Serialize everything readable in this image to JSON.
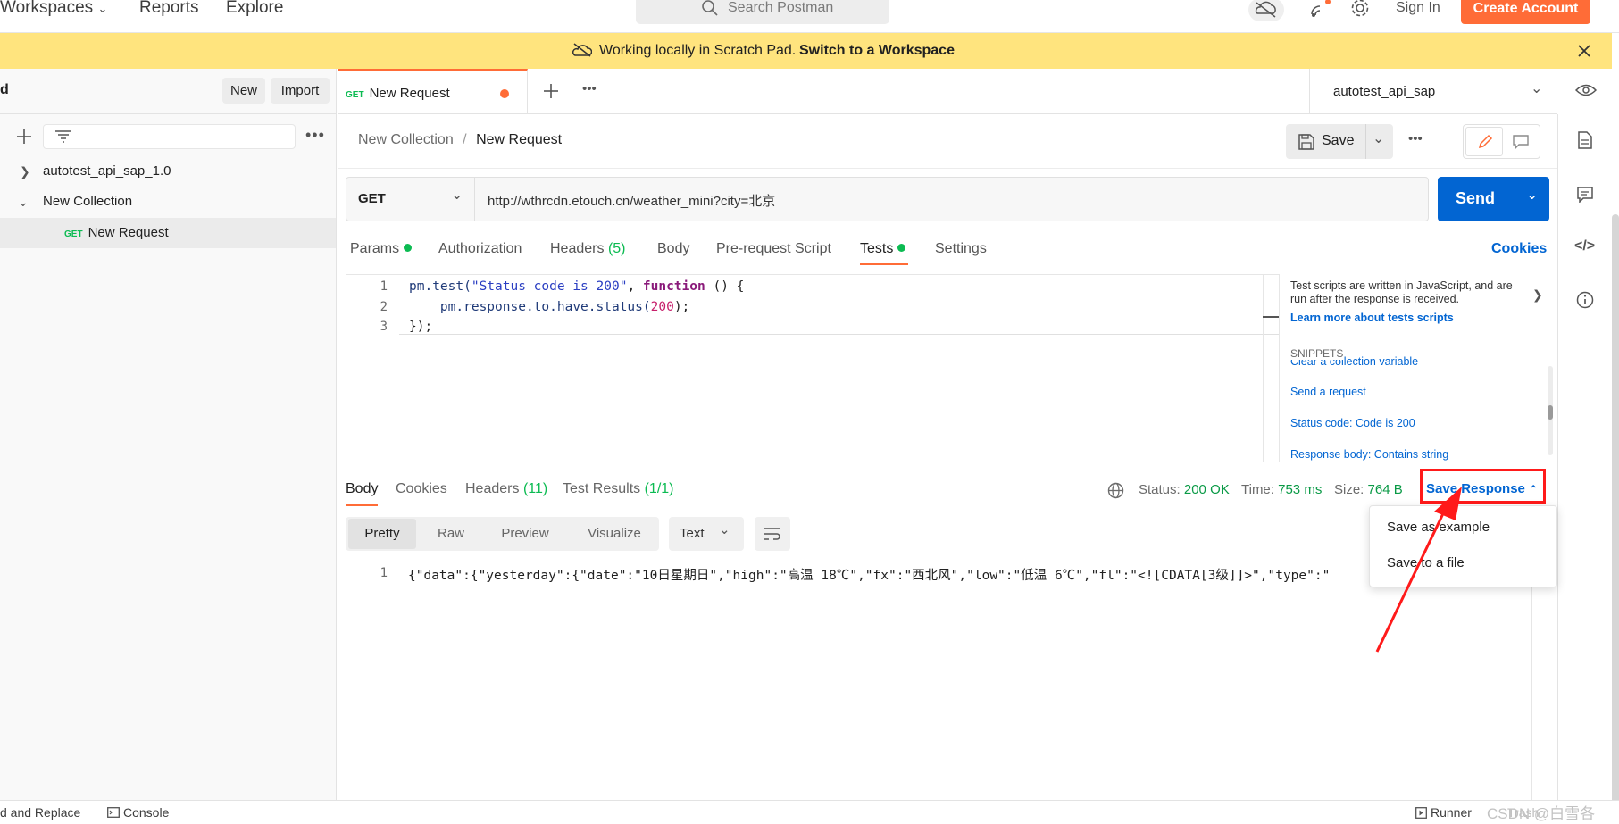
{
  "header": {
    "nav": [
      "Workspaces",
      "Reports",
      "Explore"
    ],
    "search_placeholder": "Search Postman",
    "sign_in": "Sign In",
    "create_account": "Create Account"
  },
  "banner": {
    "text": "Working locally in Scratch Pad.",
    "link": "Switch to a Workspace"
  },
  "sidebar": {
    "title_fragment": "d",
    "new_button": "New",
    "import_button": "Import",
    "tree": [
      {
        "label": "autotest_api_sap_1.0"
      },
      {
        "label": "New Collection"
      },
      {
        "method": "GET",
        "label": "New Request"
      }
    ]
  },
  "tabs": {
    "active_method": "GET",
    "active_label": "New Request"
  },
  "environment": {
    "selected": "autotest_api_sap"
  },
  "breadcrumb": {
    "collection": "New Collection",
    "separator": "/",
    "request": "New Request"
  },
  "toolbar": {
    "save_label": "Save"
  },
  "request": {
    "method": "GET",
    "url": "http://wthrcdn.etouch.cn/weather_mini?city=北京",
    "send_label": "Send"
  },
  "request_tabs": {
    "params": "Params",
    "authorization": "Authorization",
    "headers": "Headers",
    "headers_count": "(5)",
    "body": "Body",
    "pre_request": "Pre-request Script",
    "tests": "Tests",
    "settings": "Settings",
    "cookies": "Cookies"
  },
  "editor": {
    "line_numbers": [
      "1",
      "2",
      "3"
    ],
    "lines": [
      {
        "a": "pm.test(",
        "s": "\"Status code is 200\"",
        "b": ", ",
        "k": "function",
        "c": " () {"
      },
      {
        "a": "    pm.response.to.have.status(",
        "n": "200",
        "c": ");"
      },
      {
        "a": "});"
      }
    ]
  },
  "snippets_panel": {
    "description": "Test scripts are written in JavaScript, and are run after the response is received.",
    "learn_more": "Learn more about tests scripts",
    "heading": "SNIPPETS",
    "items": [
      "Clear a collection variable",
      "Send a request",
      "Status code: Code is 200",
      "Response body: Contains string"
    ]
  },
  "response": {
    "tabs": {
      "body": "Body",
      "cookies": "Cookies",
      "headers": "Headers",
      "headers_count": "(11)",
      "test_results": "Test Results",
      "test_results_count": "(1/1)"
    },
    "status_label": "Status:",
    "status_value": "200 OK",
    "time_label": "Time:",
    "time_value": "753 ms",
    "size_label": "Size:",
    "size_value": "764 B",
    "save_response": "Save Response",
    "format_buttons": [
      "Pretty",
      "Raw",
      "Preview",
      "Visualize"
    ],
    "format_type": "Text",
    "body_line_number": "1",
    "body_line": "{\"data\":{\"yesterday\":{\"date\":\"10日星期日\",\"high\":\"高温 18℃\",\"fx\":\"西北风\",\"low\":\"低温 6℃\",\"fl\":\"<![CDATA[3级]]>\",\"type\":\""
  },
  "save_dropdown": {
    "items": [
      "Save as example",
      "Save to a file"
    ]
  },
  "bottom_bar": {
    "find_replace": "d and Replace",
    "console": "Console",
    "runner": "Runner",
    "trash": "Trash"
  },
  "watermark": "CSDN @白雪各",
  "colors": {
    "accent": "#ff6c37",
    "primary_blue": "#0265d2",
    "banner": "#ffe47e",
    "success_green": "#0cbb52",
    "annotation_red": "#ff1a1a"
  }
}
